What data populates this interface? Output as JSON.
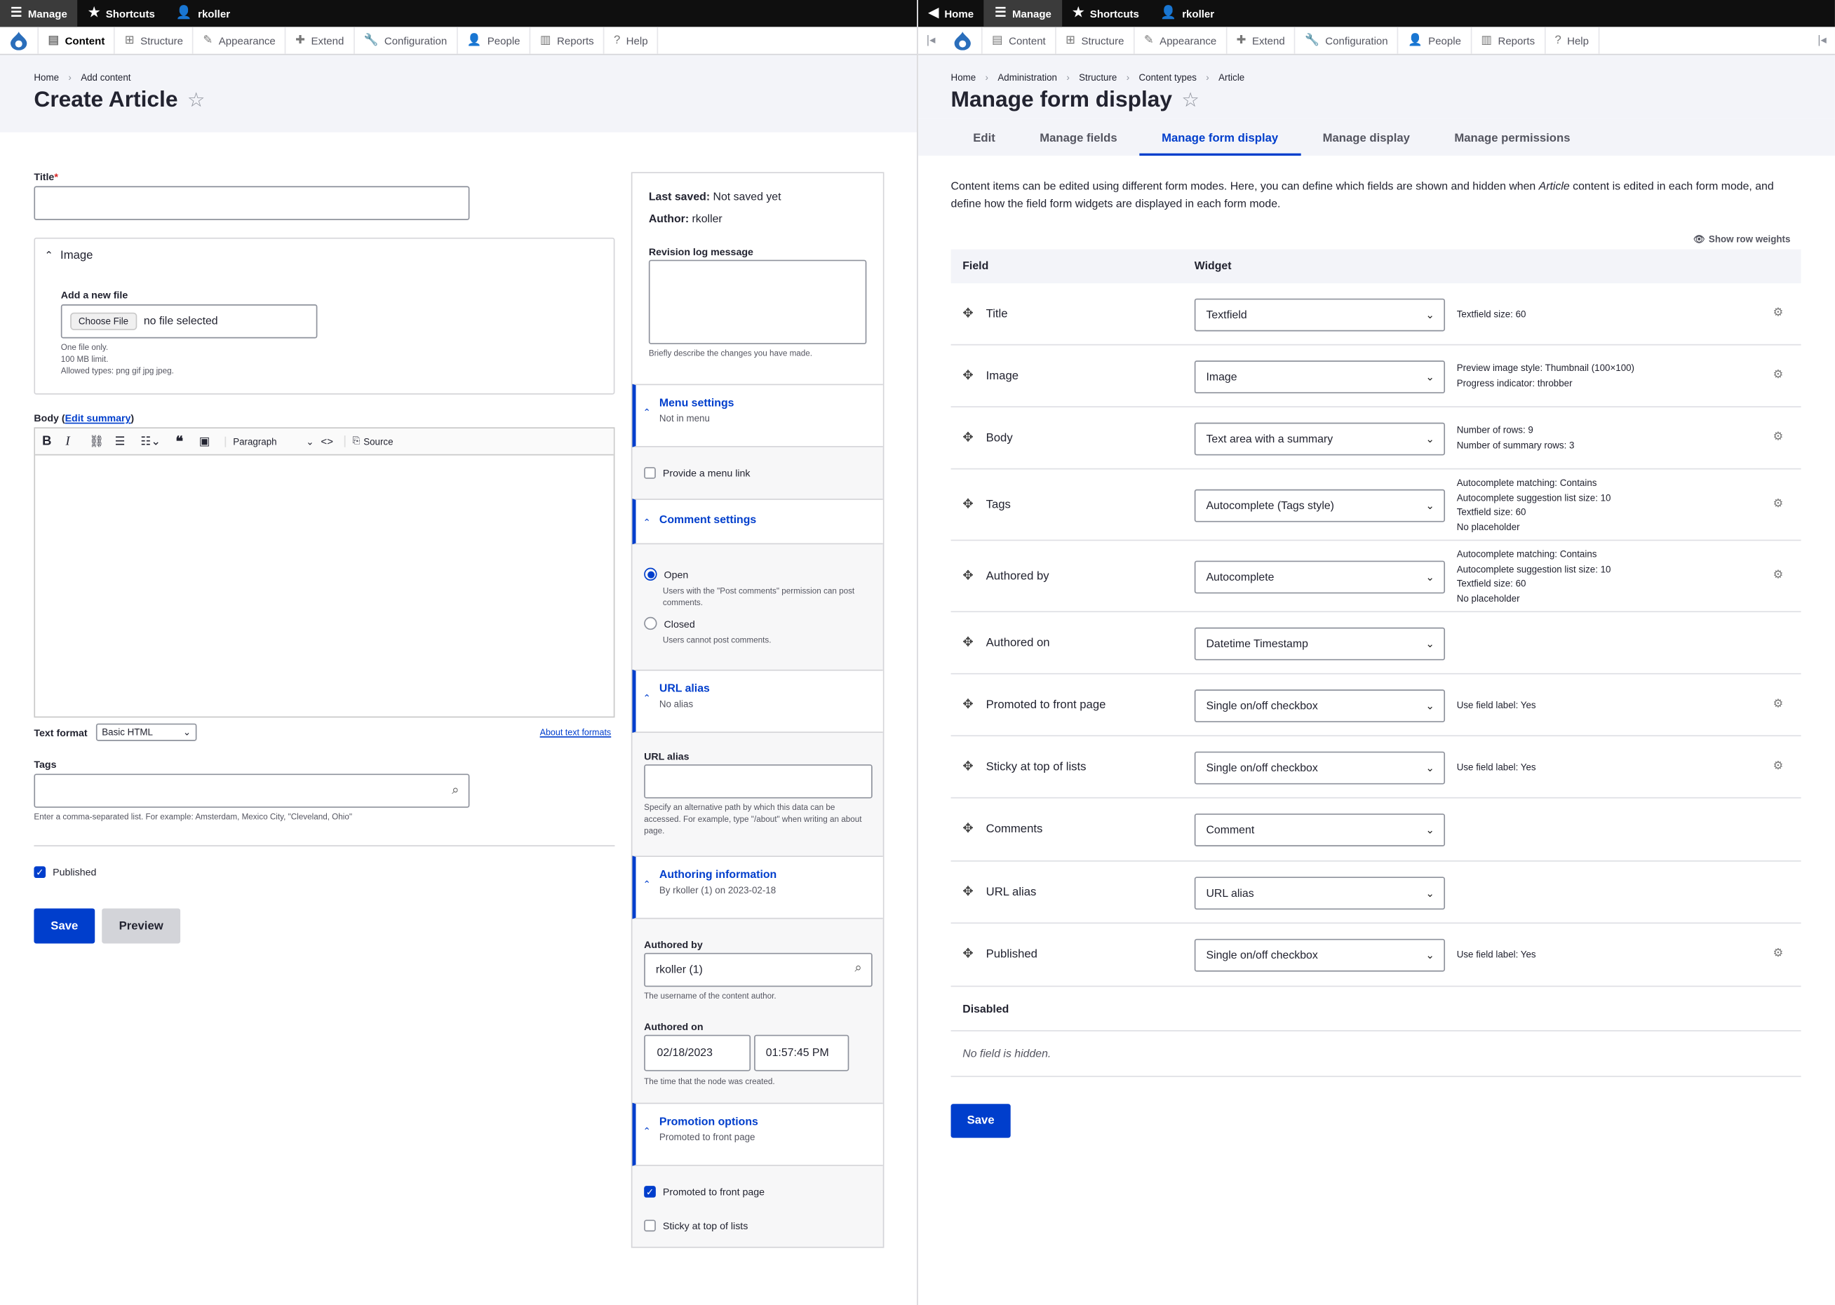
{
  "left": {
    "adminbar": {
      "manage": "Manage",
      "shortcuts": "Shortcuts",
      "user": "rkoller"
    },
    "toolbar": [
      "Content",
      "Structure",
      "Appearance",
      "Extend",
      "Configuration",
      "People",
      "Reports",
      "Help"
    ],
    "breadcrumb": [
      "Home",
      "Add content"
    ],
    "title": "Create Article",
    "form": {
      "title_label": "Title",
      "image_heading": "Image",
      "add_file_label": "Add a new file",
      "choose_file": "Choose File",
      "no_file": "no file selected",
      "file_desc": [
        "One file only.",
        "100 MB limit.",
        "Allowed types: png gif jpg jpeg."
      ],
      "body_label": "Body (",
      "edit_summary": "Edit summary",
      "body_label_end": ")",
      "paragraph": "Paragraph",
      "source": "Source",
      "text_format_label": "Text format",
      "text_format_value": "Basic HTML",
      "about_formats": "About text formats",
      "tags_label": "Tags",
      "tags_desc": "Enter a comma-separated list. For example: Amsterdam, Mexico City, \"Cleveland, Ohio\"",
      "published_label": "Published",
      "save": "Save",
      "preview": "Preview"
    },
    "sidebar": {
      "last_saved_label": "Last saved:",
      "last_saved_value": "Not saved yet",
      "author_label": "Author:",
      "author_value": "rkoller",
      "revision_label": "Revision log message",
      "revision_desc": "Briefly describe the changes you have made.",
      "menu_title": "Menu settings",
      "menu_sub": "Not in menu",
      "menu_link": "Provide a menu link",
      "comment_title": "Comment settings",
      "open_label": "Open",
      "open_desc": "Users with the \"Post comments\" permission can post comments.",
      "closed_label": "Closed",
      "closed_desc": "Users cannot post comments.",
      "url_title": "URL alias",
      "url_sub": "No alias",
      "url_label": "URL alias",
      "url_desc": "Specify an alternative path by which this data can be accessed. For example, type \"/about\" when writing an about page.",
      "authoring_title": "Authoring information",
      "authoring_sub": "By rkoller (1) on 2023-02-18",
      "authored_by_label": "Authored by",
      "authored_by_value": "rkoller (1)",
      "authored_by_desc": "The username of the content author.",
      "authored_on_label": "Authored on",
      "date_value": "02/18/2023",
      "time_value": "01:57:45 PM",
      "authored_on_desc": "The time that the node was created.",
      "promotion_title": "Promotion options",
      "promotion_sub": "Promoted to front page",
      "promoted_label": "Promoted to front page",
      "sticky_label": "Sticky at top of lists"
    }
  },
  "right": {
    "adminbar": {
      "home": "Home",
      "manage": "Manage",
      "shortcuts": "Shortcuts",
      "user": "rkoller"
    },
    "toolbar": [
      "Content",
      "Structure",
      "Appearance",
      "Extend",
      "Configuration",
      "People",
      "Reports",
      "Help"
    ],
    "breadcrumb": [
      "Home",
      "Administration",
      "Structure",
      "Content types",
      "Article"
    ],
    "title": "Manage form display",
    "tabs": [
      "Edit",
      "Manage fields",
      "Manage form display",
      "Manage display",
      "Manage permissions"
    ],
    "intro_a": "Content items can be edited using different form modes. Here, you can define which fields are shown and hidden when ",
    "intro_em": "Article",
    "intro_b": " content is edited in each form mode, and define how the field form widgets are displayed in each form mode.",
    "show_weights": "Show row weights",
    "col_field": "Field",
    "col_widget": "Widget",
    "rows": [
      {
        "name": "Title",
        "widget": "Textfield",
        "summary": [
          "Textfield size: 60"
        ],
        "gear": true
      },
      {
        "name": "Image",
        "widget": "Image",
        "summary": [
          "Preview image style: Thumbnail (100×100)",
          "Progress indicator: throbber"
        ],
        "gear": true
      },
      {
        "name": "Body",
        "widget": "Text area with a summary",
        "summary": [
          "Number of rows: 9",
          "Number of summary rows: 3"
        ],
        "gear": true
      },
      {
        "name": "Tags",
        "widget": "Autocomplete (Tags style)",
        "summary": [
          "Autocomplete matching: Contains",
          "Autocomplete suggestion list size: 10",
          "Textfield size: 60",
          "No placeholder"
        ],
        "gear": true
      },
      {
        "name": "Authored by",
        "widget": "Autocomplete",
        "summary": [
          "Autocomplete matching: Contains",
          "Autocomplete suggestion list size: 10",
          "Textfield size: 60",
          "No placeholder"
        ],
        "gear": true
      },
      {
        "name": "Authored on",
        "widget": "Datetime Timestamp",
        "summary": [],
        "gear": false
      },
      {
        "name": "Promoted to front page",
        "widget": "Single on/off checkbox",
        "summary": [
          "Use field label: Yes"
        ],
        "gear": true
      },
      {
        "name": "Sticky at top of lists",
        "widget": "Single on/off checkbox",
        "summary": [
          "Use field label: Yes"
        ],
        "gear": true
      },
      {
        "name": "Comments",
        "widget": "Comment",
        "summary": [],
        "gear": false
      },
      {
        "name": "URL alias",
        "widget": "URL alias",
        "summary": [],
        "gear": false
      },
      {
        "name": "Published",
        "widget": "Single on/off checkbox",
        "summary": [
          "Use field label: Yes"
        ],
        "gear": true
      }
    ],
    "disabled_label": "Disabled",
    "no_hidden": "No field is hidden.",
    "save": "Save"
  }
}
